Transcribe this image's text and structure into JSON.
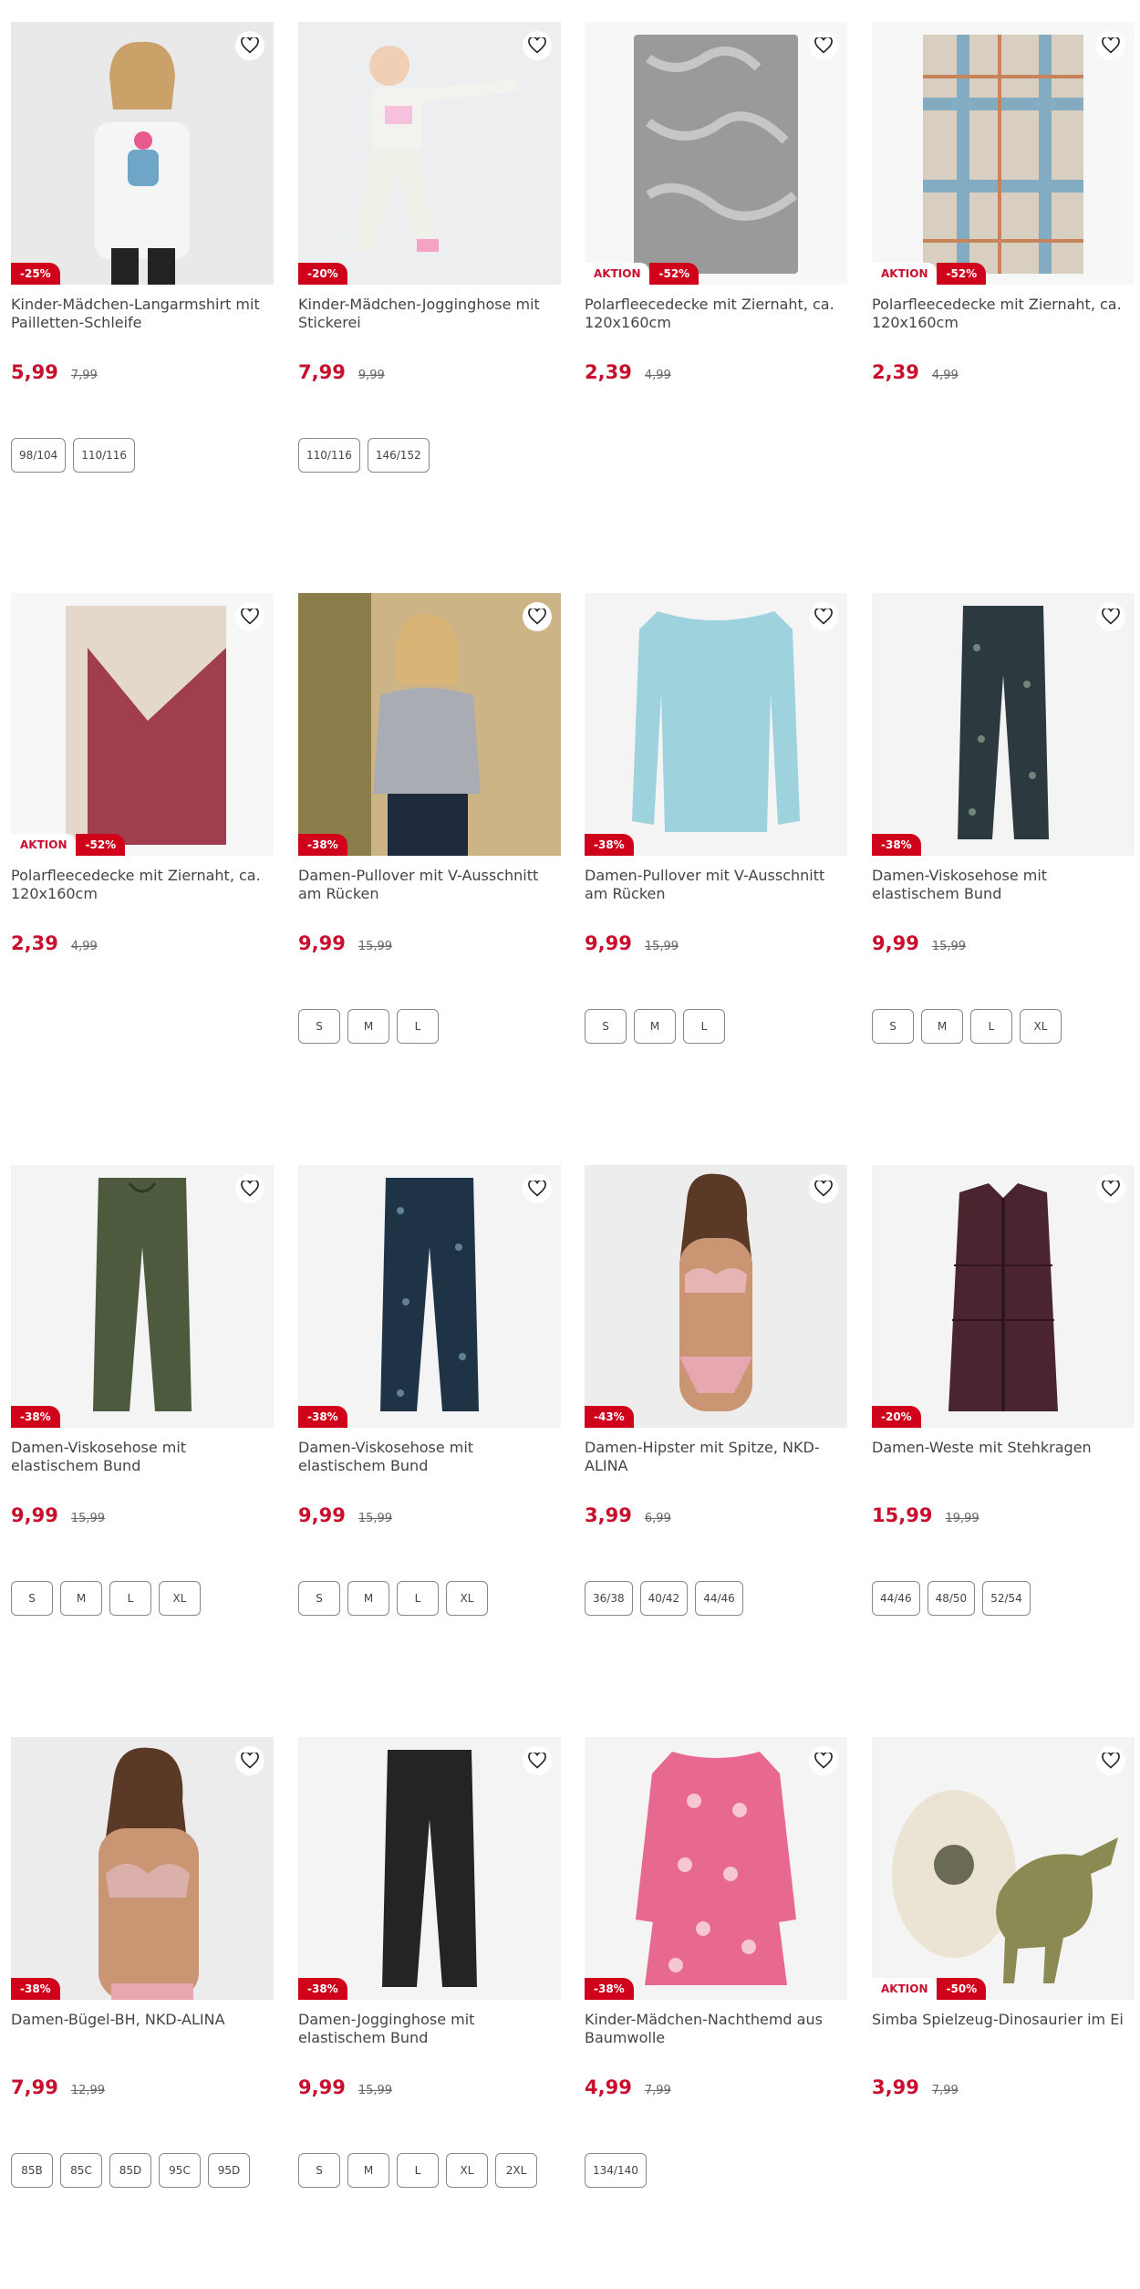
{
  "colors": {
    "accent": "#c8102e",
    "badge": "#d0021b"
  },
  "products": [
    {
      "title": "Kinder-Mädchen-Langarmshirt mit Pailletten-Schleife",
      "price": "5,99",
      "old": "7,99",
      "aktion": "",
      "discount": "-25%",
      "sizes": [
        "98/104",
        "110/116"
      ],
      "image": "girl-longsleeve"
    },
    {
      "title": "Kinder-Mädchen-Jogginghose mit Stickerei",
      "price": "7,99",
      "old": "9,99",
      "aktion": "",
      "discount": "-20%",
      "sizes": [
        "110/116",
        "146/152"
      ],
      "image": "girl-joggers"
    },
    {
      "title": "Polarfleecedecke mit Ziernaht, ca. 120x160cm",
      "price": "2,39",
      "old": "4,99",
      "aktion": "AKTION",
      "discount": "-52%",
      "sizes": [],
      "image": "grey-floral-blanket"
    },
    {
      "title": "Polarfleecedecke mit Ziernaht, ca. 120x160cm",
      "price": "2,39",
      "old": "4,99",
      "aktion": "AKTION",
      "discount": "-52%",
      "sizes": [],
      "image": "plaid-blanket"
    },
    {
      "title": "Polarfleecedecke mit Ziernaht, ca. 120x160cm",
      "price": "2,39",
      "old": "4,99",
      "aktion": "AKTION",
      "discount": "-52%",
      "sizes": [],
      "image": "red-blanket"
    },
    {
      "title": "Damen-Pullover mit V-Ausschnitt am Rücken",
      "price": "9,99",
      "old": "15,99",
      "aktion": "",
      "discount": "-38%",
      "sizes": [
        "S",
        "M",
        "L"
      ],
      "image": "woman-grey-pullover"
    },
    {
      "title": "Damen-Pullover mit V-Ausschnitt am Rücken",
      "price": "9,99",
      "old": "15,99",
      "aktion": "",
      "discount": "-38%",
      "sizes": [
        "S",
        "M",
        "L"
      ],
      "image": "blue-pullover"
    },
    {
      "title": "Damen-Viskosehose mit elastischem Bund",
      "price": "9,99",
      "old": "15,99",
      "aktion": "",
      "discount": "-38%",
      "sizes": [
        "S",
        "M",
        "L",
        "XL"
      ],
      "image": "patterned-trousers"
    },
    {
      "title": "Damen-Viskosehose mit elastischem Bund",
      "price": "9,99",
      "old": "15,99",
      "aktion": "",
      "discount": "-38%",
      "sizes": [
        "S",
        "M",
        "L",
        "XL"
      ],
      "image": "olive-trousers"
    },
    {
      "title": "Damen-Viskosehose mit elastischem Bund",
      "price": "9,99",
      "old": "15,99",
      "aktion": "",
      "discount": "-38%",
      "sizes": [
        "S",
        "M",
        "L",
        "XL"
      ],
      "image": "navy-patterned-trousers"
    },
    {
      "title": "Damen-Hipster mit Spitze, NKD-ALINA",
      "price": "3,99",
      "old": "6,99",
      "aktion": "",
      "discount": "-43%",
      "sizes": [
        "36/38",
        "40/42",
        "44/46"
      ],
      "image": "woman-lingerie"
    },
    {
      "title": "Damen-Weste mit Stehkragen",
      "price": "15,99",
      "old": "19,99",
      "aktion": "",
      "discount": "-20%",
      "sizes": [
        "44/46",
        "48/50",
        "52/54"
      ],
      "image": "burgundy-vest"
    },
    {
      "title": "Damen-Bügel-BH, NKD-ALINA",
      "price": "7,99",
      "old": "12,99",
      "aktion": "",
      "discount": "-38%",
      "sizes": [
        "85B",
        "85C",
        "85D",
        "95C",
        "95D"
      ],
      "image": "woman-bra"
    },
    {
      "title": "Damen-Jogginghose mit elastischem Bund",
      "price": "9,99",
      "old": "15,99",
      "aktion": "",
      "discount": "-38%",
      "sizes": [
        "S",
        "M",
        "L",
        "XL",
        "2XL"
      ],
      "image": "black-joggers"
    },
    {
      "title": "Kinder-Mädchen-Nachthemd aus Baumwolle",
      "price": "4,99",
      "old": "7,99",
      "aktion": "",
      "discount": "-38%",
      "sizes": [
        "134/140"
      ],
      "image": "pink-heart-nightdress"
    },
    {
      "title": "Simba Spielzeug-Dinosaurier im Ei",
      "price": "3,99",
      "old": "7,99",
      "aktion": "AKTION",
      "discount": "-50%",
      "sizes": [],
      "image": "dino-egg-toy"
    }
  ]
}
